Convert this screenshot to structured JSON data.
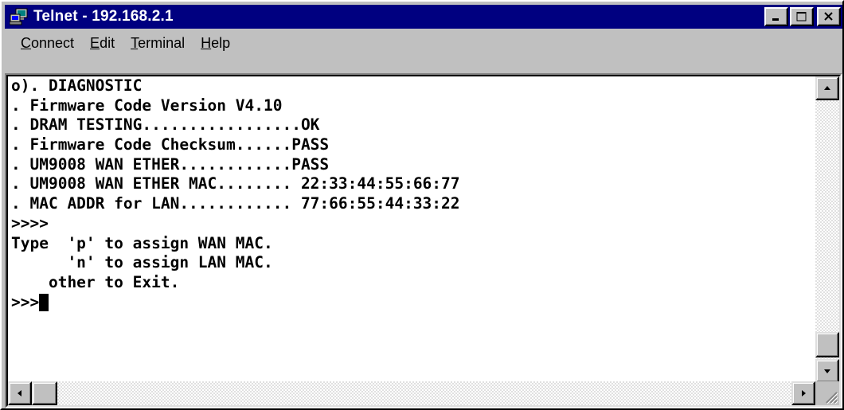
{
  "window": {
    "title": "Telnet - 192.168.2.1",
    "icon": "telnet-app-icon"
  },
  "menu": [
    {
      "accel": "C",
      "rest": "onnect"
    },
    {
      "accel": "E",
      "rest": "dit"
    },
    {
      "accel": "T",
      "rest": "erminal"
    },
    {
      "accel": "H",
      "rest": "elp"
    }
  ],
  "terminal": {
    "lines": [
      "o). DIAGNOSTIC",
      ". Firmware Code Version V4.10",
      ". DRAM TESTING.................OK",
      ". Firmware Code Checksum......PASS",
      ". UM9008 WAN ETHER............PASS",
      ". UM9008 WAN ETHER MAC........ 22:33:44:55:66:77",
      ". MAC ADDR for LAN............ 77:66:55:44:33:22",
      ">>>>",
      "Type  'p' to assign WAN MAC.",
      "      'n' to assign LAN MAC.",
      "    other to Exit.",
      ">>>"
    ]
  },
  "colors": {
    "titlebar": "#000080",
    "chrome": "#c0c0c0",
    "terminal_bg": "#ffffff",
    "terminal_fg": "#000000"
  },
  "scroll": {
    "vertical_position": 1.0,
    "horizontal_position": 0.0
  }
}
